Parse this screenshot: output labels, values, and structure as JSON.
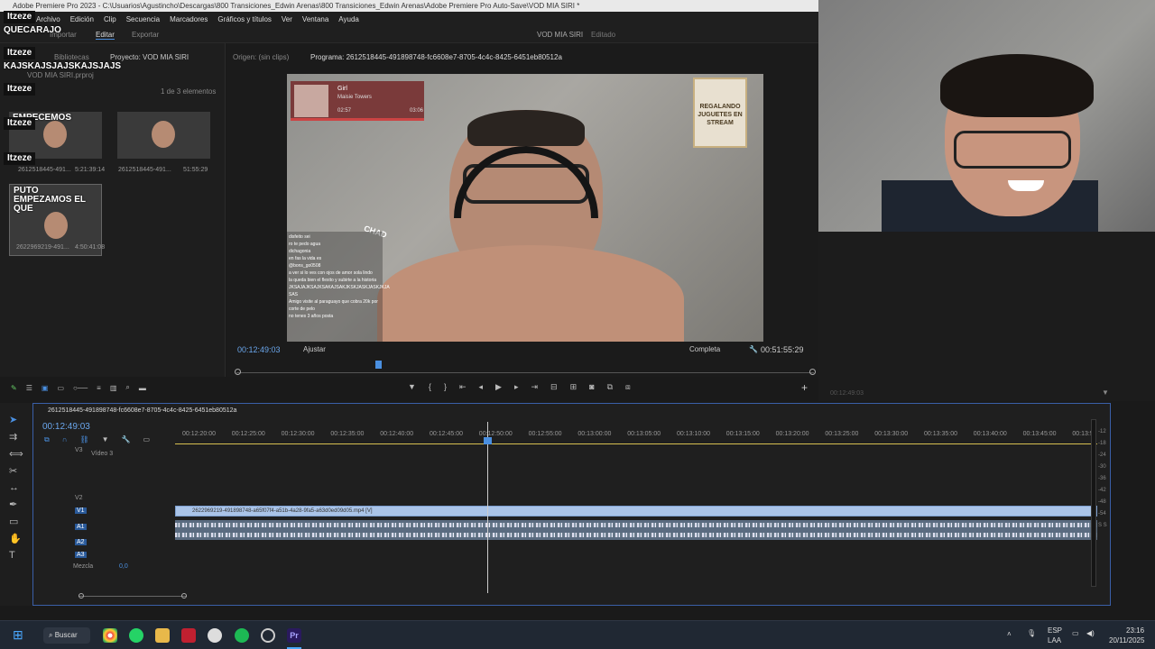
{
  "window": {
    "title": "Adobe Premiere Pro 2023 - C:\\Usuarios\\Agustincho\\Descargas\\800 Transiciones_Edwin Arenas\\800 Transiciones_Edwin Arenas\\Adobe Premiere Pro Auto-Save\\VOD MIA SIRI *",
    "menu": [
      "Archivo",
      "Edición",
      "Clip",
      "Secuencia",
      "Marcadores",
      "Gráficos y títulos",
      "Ver",
      "Ventana",
      "Ayuda"
    ]
  },
  "workspace": {
    "tabs": [
      "Importar",
      "Editar",
      "Exportar"
    ],
    "active": "Editar",
    "project_name": "VOD MIA SIRI",
    "status": "Editado"
  },
  "chat_overlay": {
    "lines": [
      {
        "user": "Itzeze",
        "text": "QUECARAJO"
      },
      {
        "user": "Itzeze",
        "text": "KAJSKAJSJAJSKAJSJAJS"
      },
      {
        "user": "Itzeze",
        "text": ""
      },
      {
        "user": "Itzeze",
        "text": ""
      },
      {
        "user": "Itzeze",
        "text": ""
      }
    ]
  },
  "project_panel": {
    "tabs": [
      "Bibliotecas",
      "Proyecto: VOD MIA SIRI"
    ],
    "file": "VOD MIA SIRI.prproj",
    "count": "1 de 3 elementos",
    "items": [
      {
        "name": "2612518445-491...",
        "duration": "5:21:39:14",
        "caption": "EMPECEMOS"
      },
      {
        "name": "2612518445-491...",
        "duration": "51:55:29",
        "caption": ""
      },
      {
        "name": "2622969219-491...",
        "duration": "4:50:41:08",
        "caption": "PUTO EMPEZAMOS EL QUE"
      }
    ]
  },
  "source_monitor": {
    "label": "Origen: (sin clips)"
  },
  "program_monitor": {
    "tab": "Programa: 2612518445-491898748-fc6608e7-8705-4c4c-8425-6451eb80512a",
    "timecode": "00:12:49:03",
    "fit": "Ajustar",
    "quality": "Completa",
    "duration": "00:51:55:29",
    "progress": 0.24
  },
  "stream_overlay": {
    "song_title": "Girl",
    "song_artist": "Maisie Towers",
    "song_elapsed": "02:57",
    "song_total": "03:06",
    "banner": "REGALANDO JUGUETES EN STREAM",
    "chad": "CHAD",
    "chat": [
      "disfeito sei",
      "ro te pedo agua",
      "dichagonia",
      "en fas la vida es",
      "@bons_go0508",
      "a ver si lo ves con ojos de amor sola lindo",
      "la queda bien el flexito y subirte a la historia",
      "JKSAJAJKSAJKSAKAJSAKJKSKJASKJASKJKJA SAS",
      "Amigo visite al paraguayo que cobra 20k por corte de pelo",
      "no tenes 3 años posta"
    ]
  },
  "right_panel": {
    "timecode": "00:12:49:03"
  },
  "timeline": {
    "sequence_tab": "2612518445-491898748-fc6608e7-8705-4c4c-8425-6451eb80512a",
    "timecode": "00:12:49:03",
    "ruler": [
      "00:12:20:00",
      "00:12:25:00",
      "00:12:30:00",
      "00:12:35:00",
      "00:12:40:00",
      "00:12:45:00",
      "00:12:50:00",
      "00:12:55:00",
      "00:13:00:00",
      "00:13:05:00",
      "00:13:10:00",
      "00:13:15:00",
      "00:13:20:00",
      "00:13:25:00",
      "00:13:30:00",
      "00:13:35:00",
      "00:13:40:00",
      "00:13:45:00",
      "00:13:5"
    ],
    "tracks": {
      "video": [
        "V3",
        "V2",
        "V1"
      ],
      "video3_label": "Vídeo 3",
      "audio": [
        "A1",
        "A2",
        "A3"
      ],
      "mix_label": "Mezcla",
      "mix_value": "0,0"
    },
    "clip_name": "2622969219-491898748-a65f07f4-a51b-4a28-9fa5-a63d0ed09d05.mp4 [V]",
    "meter_labels": [
      "-12",
      "-18",
      "-24",
      "-30",
      "-36",
      "-42",
      "-48",
      "-54",
      "S S"
    ]
  },
  "taskbar": {
    "search": "Buscar",
    "lang": "ESP",
    "lang2": "LAA",
    "time": "23:16",
    "date": "20/11/2025"
  },
  "colors": {
    "accent_blue": "#4a8fe0",
    "timecode_blue": "#6aa6ec",
    "clip_video": "#aac4e8",
    "timeline_border": "#3a5fa8"
  }
}
